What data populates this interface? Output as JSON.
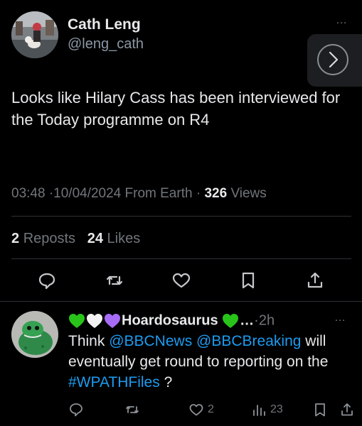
{
  "tweet": {
    "author_name": "Cath Leng",
    "author_handle": "@leng_cath",
    "more": "…",
    "text": "Looks like Hilary Cass has been interviewed for the Today programme on R4",
    "time": "03:48",
    "sep1": "·",
    "date": "10/04/2024",
    "source": "From Earth",
    "sep2": "·",
    "views_count": "326",
    "views_label": "Views",
    "reposts_count": "2",
    "reposts_label": "Reposts",
    "likes_count": "24",
    "likes_label": "Likes"
  },
  "reply": {
    "author_name": "Hoardosaurus",
    "ellipsis": "…",
    "sep": "·",
    "time": "2h",
    "more": "…",
    "text_part1": "Think ",
    "mention1": "@BBCNews",
    "text_space": " ",
    "mention2": "@BBCBreaking",
    "text_part2": " will eventually get round to reporting on the ",
    "hashtag": "#WPATHFiles",
    "text_part3": " ?",
    "likes": "2",
    "views": "23"
  },
  "icons": {
    "reply": "comment-icon",
    "repost": "repost-icon",
    "like": "heart-icon",
    "bookmark": "bookmark-icon",
    "share": "share-icon",
    "views": "views-icon",
    "next": "chevron-right-icon"
  },
  "colors": {
    "background": "#000000",
    "text": "#e7e9ea",
    "secondary": "#71767b",
    "link": "#1d9bf0",
    "green_heart": "#29c41a",
    "purple_heart": "#a76cf6"
  }
}
